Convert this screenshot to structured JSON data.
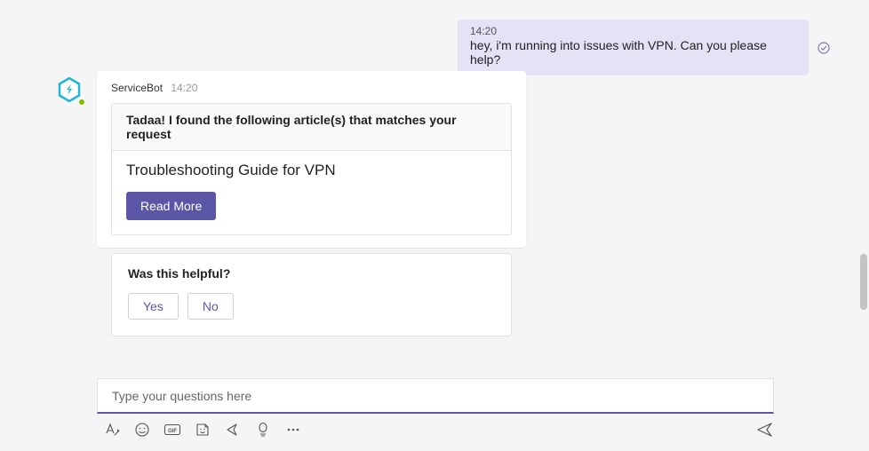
{
  "user_message": {
    "time": "14:20",
    "text": "hey, i'm running into issues with VPN. Can you please help?"
  },
  "bot": {
    "name": "ServiceBot",
    "time": "14:20",
    "article_card": {
      "header": "Tadaa! I found the following article(s) that matches your request",
      "title": "Troubleshooting Guide for VPN",
      "button": "Read More"
    },
    "feedback": {
      "question": "Was this helpful?",
      "yes": "Yes",
      "no": "No"
    }
  },
  "compose": {
    "placeholder": "Type your questions here"
  }
}
